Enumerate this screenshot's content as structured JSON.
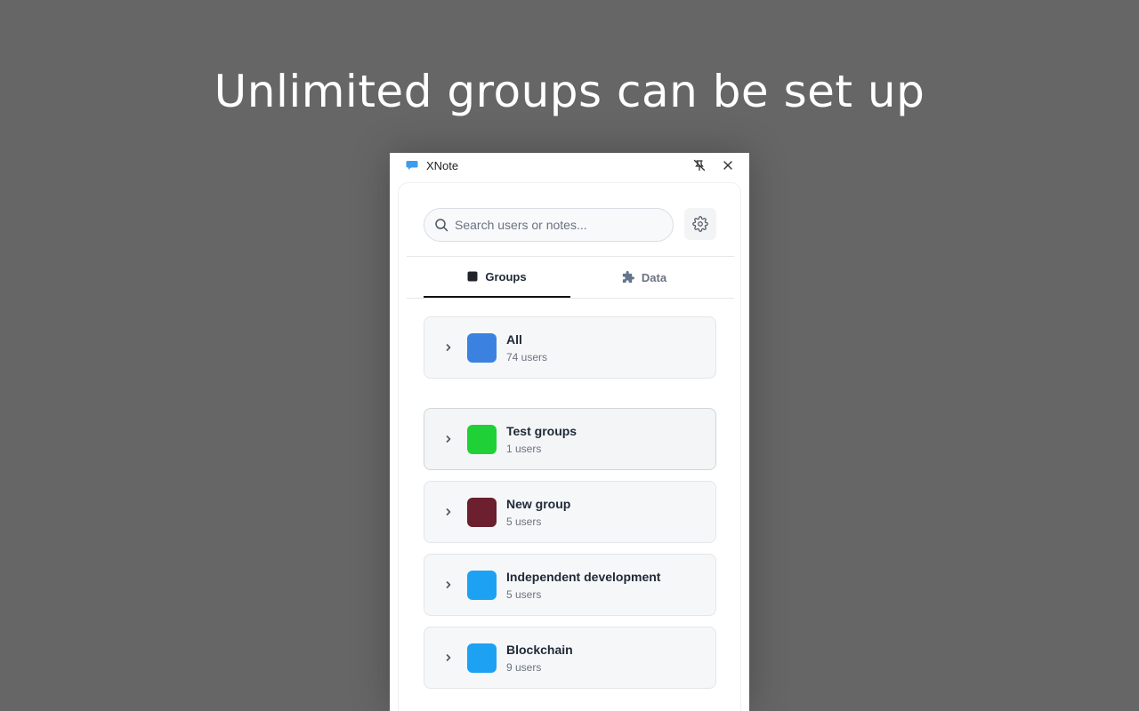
{
  "headline": "Unlimited groups can be set up",
  "window": {
    "title": "XNote",
    "accent_color": "#3b9cf0"
  },
  "search": {
    "placeholder": "Search users or notes..."
  },
  "tabs": [
    {
      "label": "Groups",
      "icon": "square-icon",
      "active": true
    },
    {
      "label": "Data",
      "icon": "puzzle-icon",
      "active": false
    }
  ],
  "groups": [
    {
      "name": "All",
      "count": "74 users",
      "color": "#3b82e0"
    },
    {
      "name": "Test groups",
      "count": "1 users",
      "color": "#1fd137"
    },
    {
      "name": "New group",
      "count": "5 users",
      "color": "#6b1f2f"
    },
    {
      "name": "Independent development",
      "count": "5 users",
      "color": "#1da1f2"
    },
    {
      "name": "Blockchain",
      "count": "9 users",
      "color": "#1da1f2"
    }
  ]
}
